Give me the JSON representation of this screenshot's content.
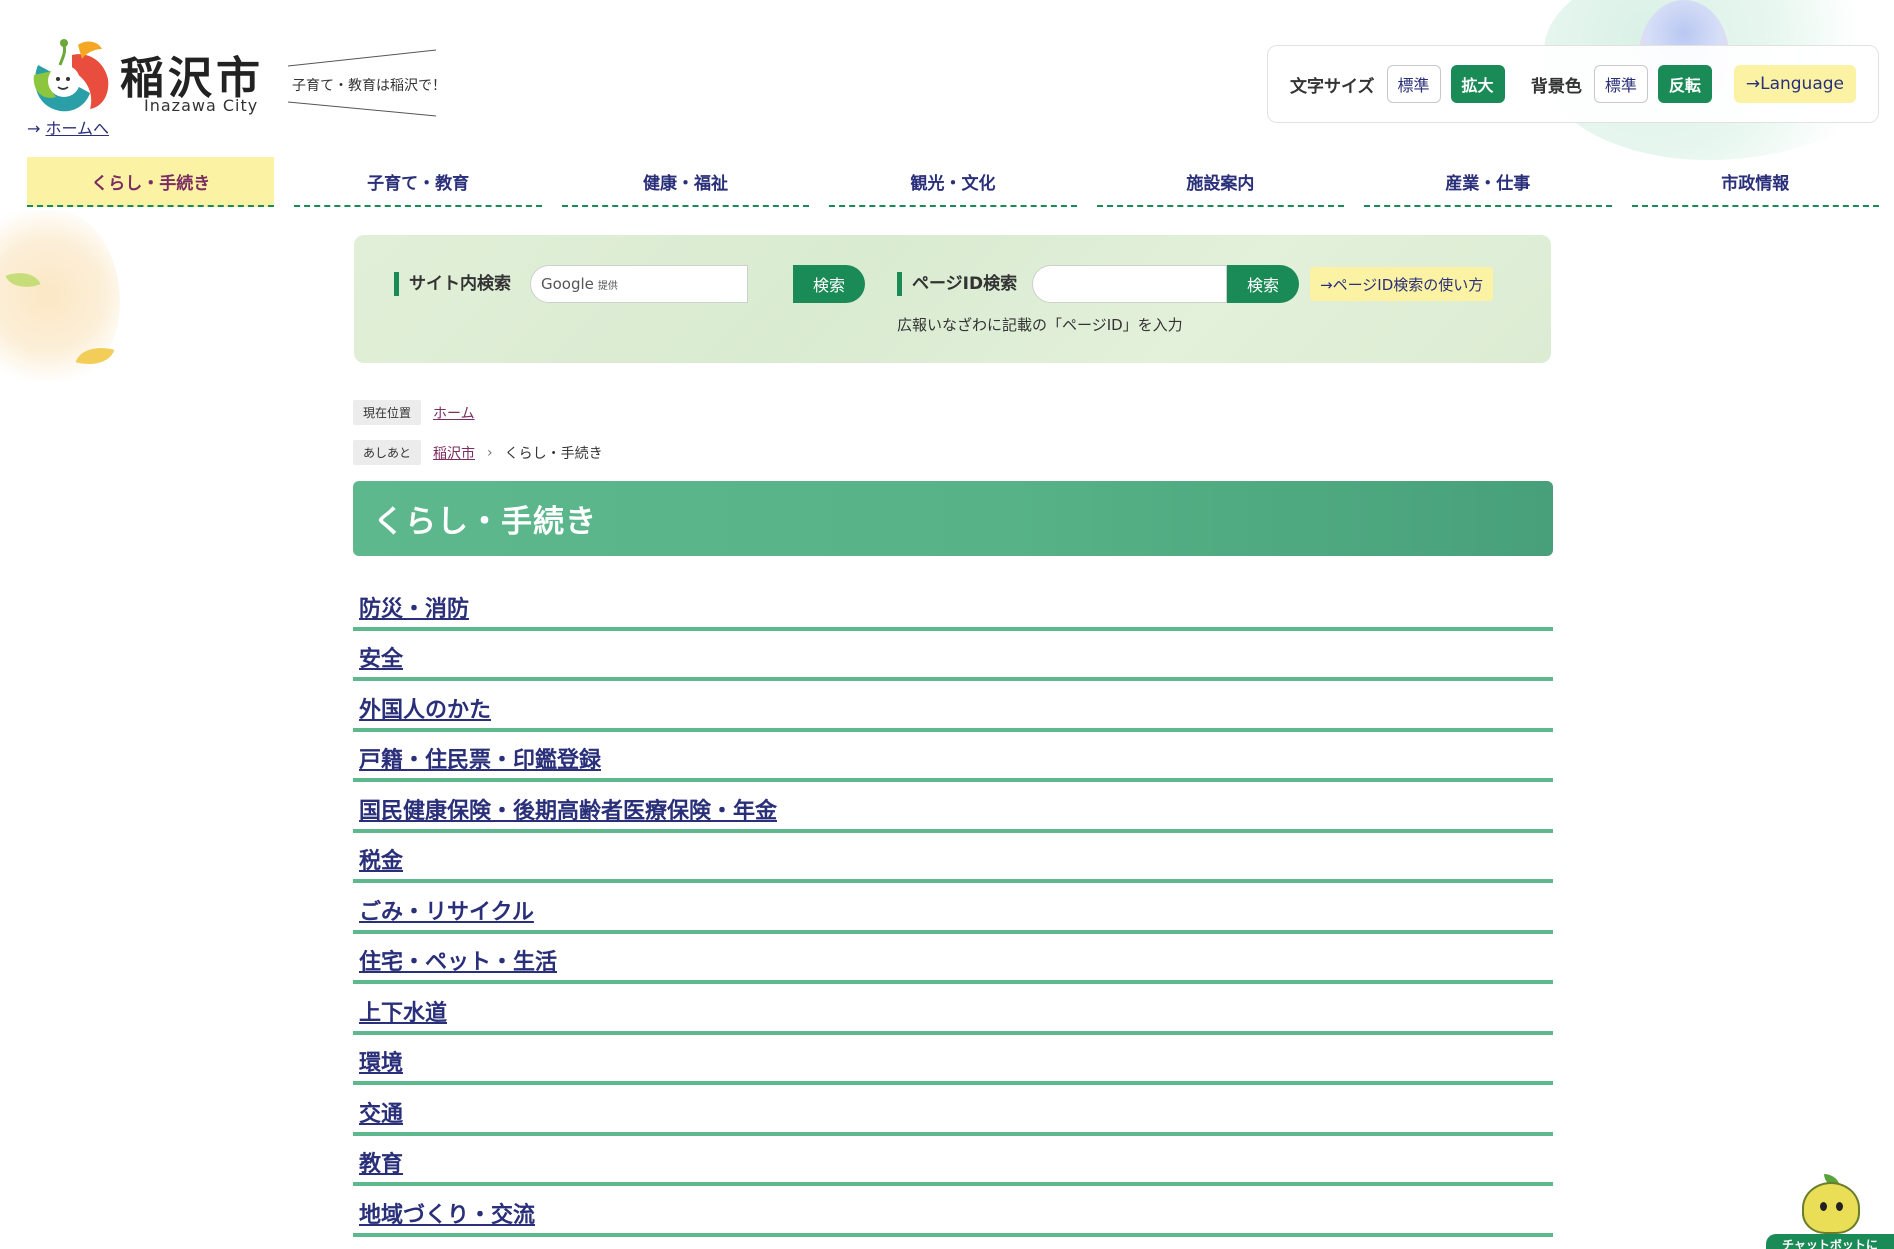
{
  "header": {
    "city_name": "稲沢市",
    "city_name_en": "Inazawa City",
    "home_link_arrow": "→",
    "home_link": "ホームへ",
    "tagline": "子育て・教育は稲沢で！"
  },
  "utility": {
    "font_size_label": "文字サイズ",
    "font_size_standard": "標準",
    "font_size_large": "拡大",
    "bg_color_label": "背景色",
    "bg_standard": "標準",
    "bg_invert": "反転",
    "language": "→Language"
  },
  "nav": {
    "items": [
      {
        "label": "くらし・手続き",
        "active": true
      },
      {
        "label": "子育て・教育"
      },
      {
        "label": "健康・福祉"
      },
      {
        "label": "観光・文化"
      },
      {
        "label": "施設案内"
      },
      {
        "label": "産業・仕事"
      },
      {
        "label": "市政情報"
      }
    ]
  },
  "search": {
    "site_label": "サイト内検索",
    "site_placeholder_brand": "Google",
    "site_placeholder_suffix": "提供",
    "site_button": "検索",
    "pageid_label": "ページID検索",
    "pageid_button": "検索",
    "pageid_howto": "→ページID検索の使い方",
    "pageid_note": "広報いなざわに記載の「ページID」を入力"
  },
  "breadcrumb": {
    "current_position_tag": "現在位置",
    "home": "ホーム",
    "trail_tag": "あしあと",
    "trail_root": "稲沢市",
    "separator": "›",
    "trail_current": "くらし・手続き"
  },
  "page": {
    "title": "くらし・手続き"
  },
  "categories": [
    "防災・消防",
    "安全",
    "外国人のかた",
    "戸籍・住民票・印鑑登録",
    "国民健康保険・後期高齢者医療保険・年金",
    "税金",
    "ごみ・リサイクル",
    "住宅・ペット・生活",
    "上下水道",
    "環境",
    "交通",
    "教育",
    "地域づくり・交流"
  ],
  "chatbot": {
    "label": "チャットボットに"
  },
  "colors": {
    "primary_green": "#1a8a56",
    "title_green": "#5db88d",
    "highlight_yellow": "#fbf3a3",
    "link_navy": "#2a2f7a",
    "active_nav_text": "#7a2c63"
  }
}
